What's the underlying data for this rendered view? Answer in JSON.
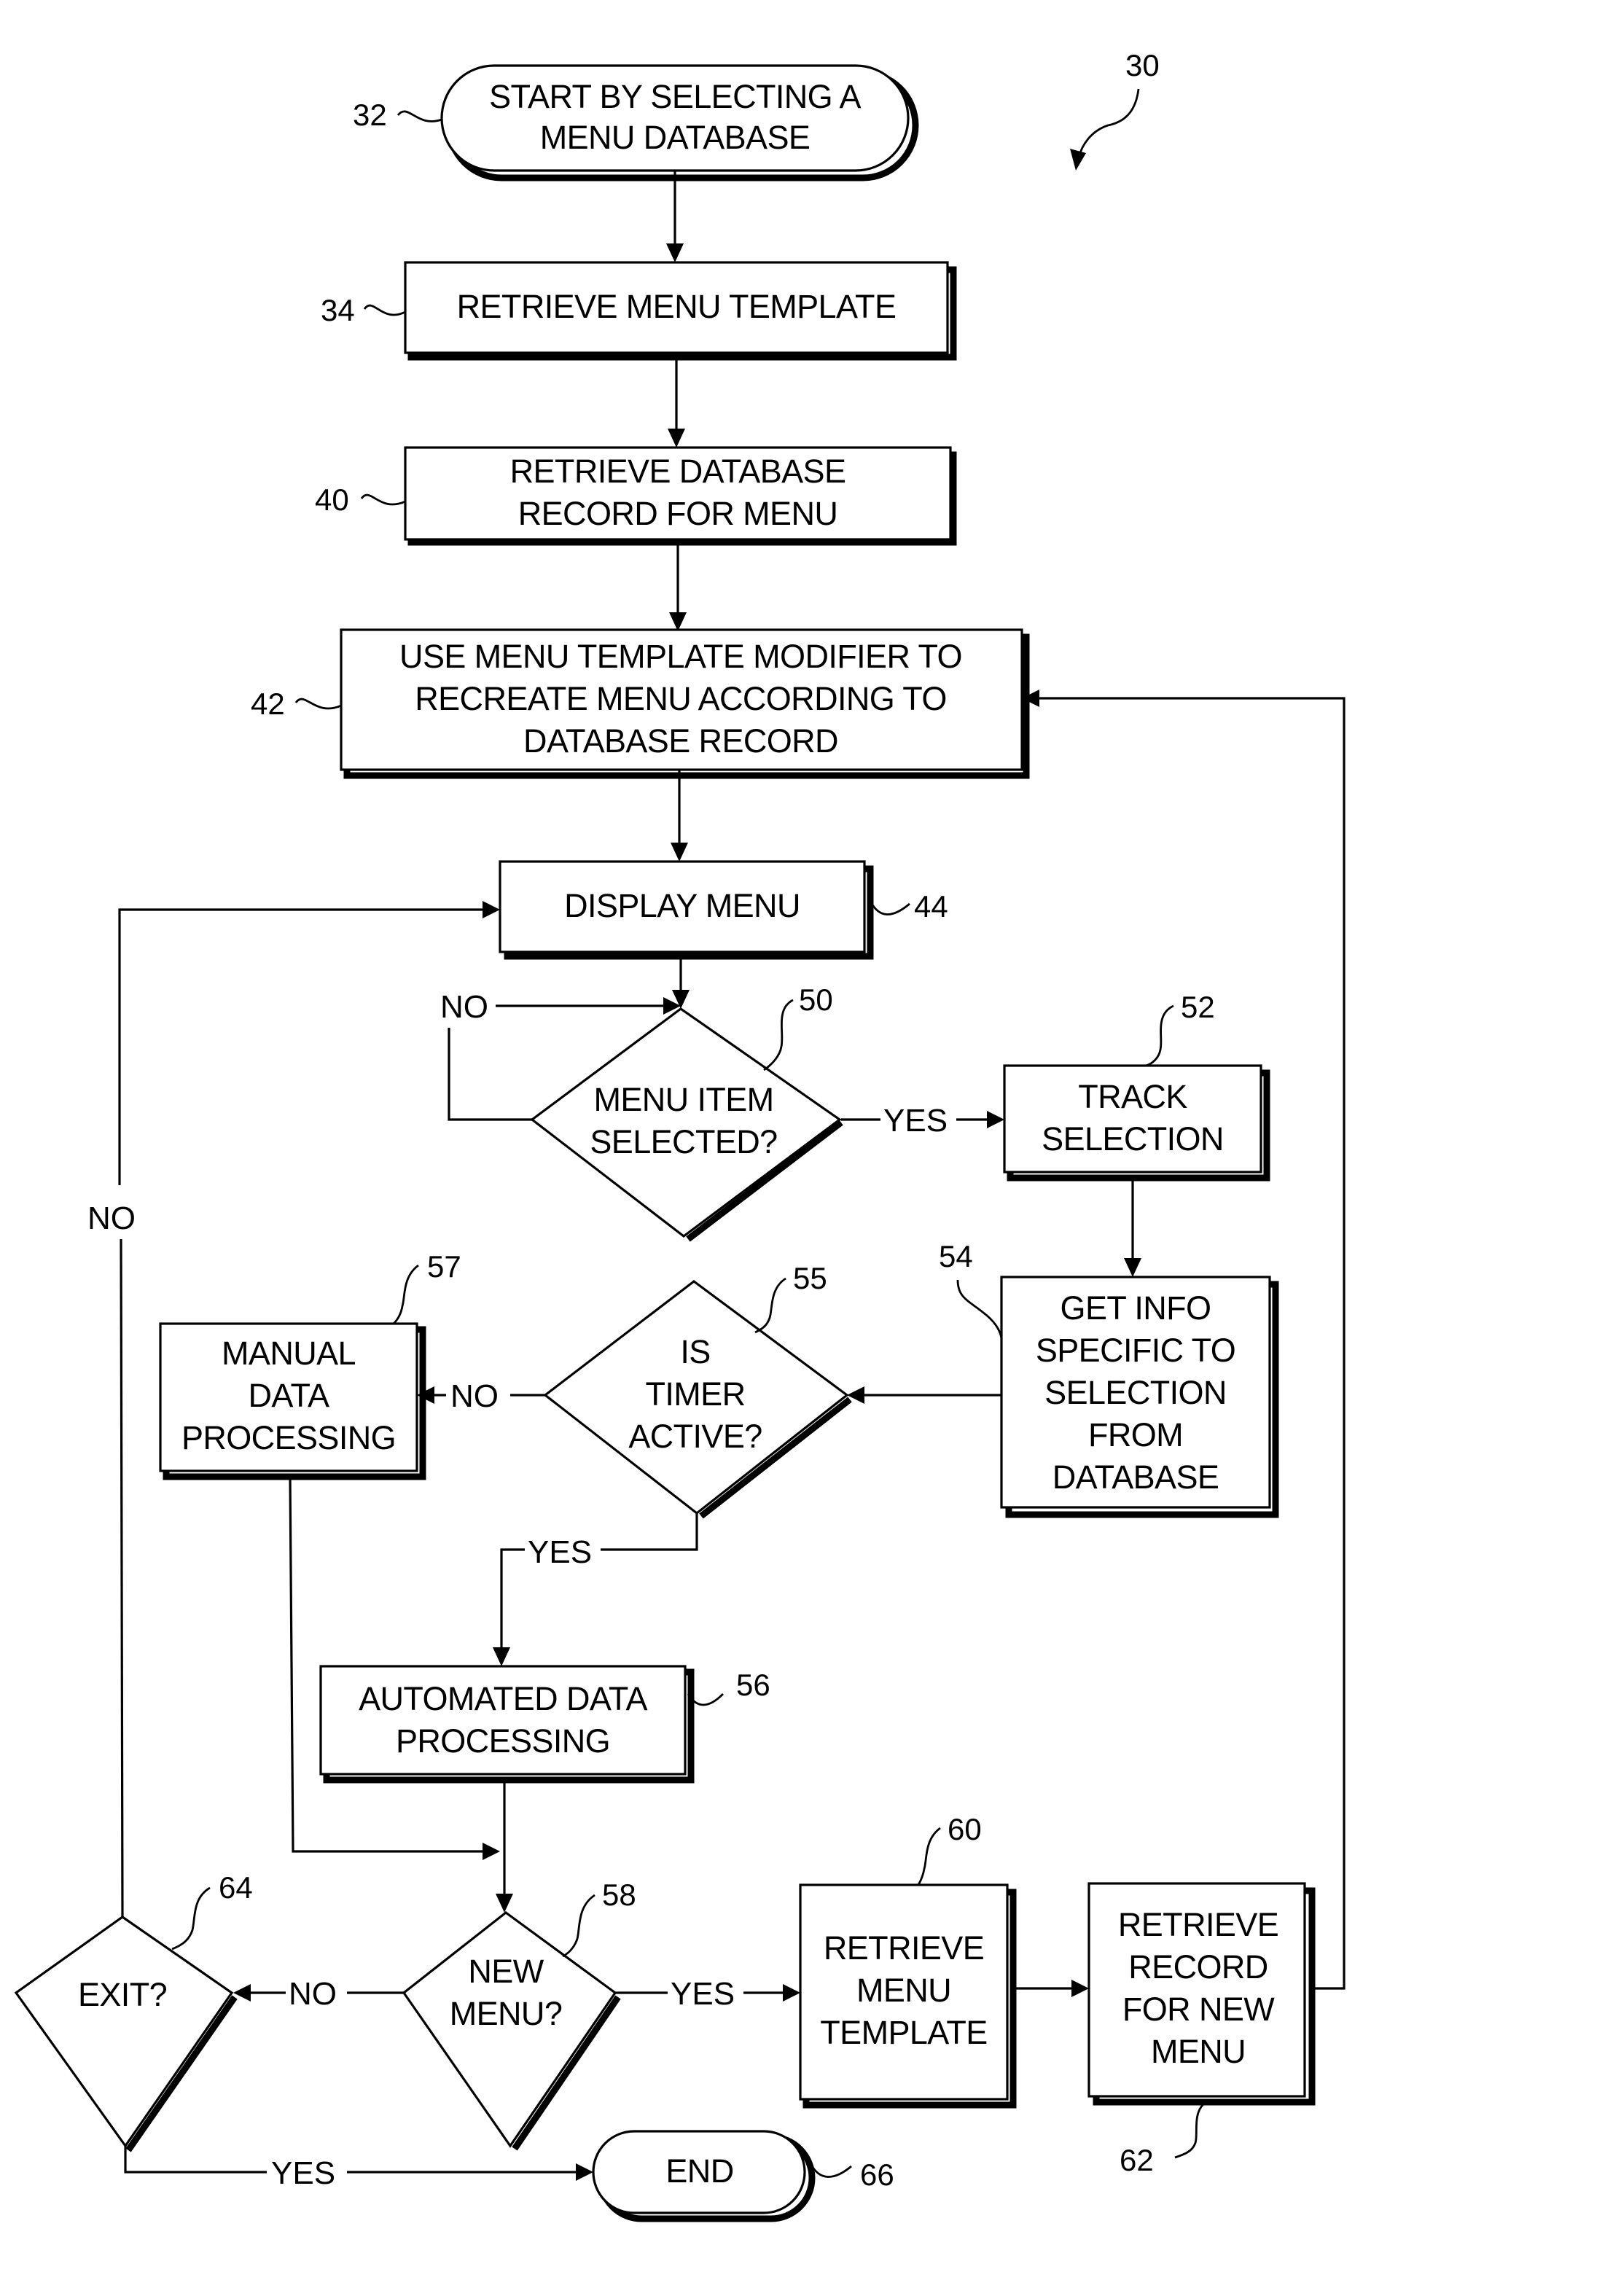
{
  "figure": {
    "reference": "30",
    "colors": {
      "ink": "#000000",
      "paper": "#ffffff"
    }
  },
  "nodes": {
    "n32": {
      "ref": "32",
      "kind": "terminal",
      "lines": [
        "START BY SELECTING A",
        "MENU DATABASE"
      ]
    },
    "n34": {
      "ref": "34",
      "kind": "process",
      "lines": [
        "RETRIEVE MENU TEMPLATE"
      ]
    },
    "n40": {
      "ref": "40",
      "kind": "process",
      "lines": [
        "RETRIEVE DATABASE",
        "RECORD FOR MENU"
      ]
    },
    "n42": {
      "ref": "42",
      "kind": "process",
      "lines": [
        "USE MENU TEMPLATE MODIFIER TO",
        "RECREATE MENU ACCORDING TO",
        "DATABASE RECORD"
      ]
    },
    "n44": {
      "ref": "44",
      "kind": "process",
      "lines": [
        "DISPLAY MENU"
      ]
    },
    "n50": {
      "ref": "50",
      "kind": "decision",
      "lines": [
        "MENU ITEM",
        "SELECTED?"
      ]
    },
    "n52": {
      "ref": "52",
      "kind": "process",
      "lines": [
        "TRACK",
        "SELECTION"
      ]
    },
    "n54": {
      "ref": "54",
      "kind": "process",
      "lines": [
        "GET INFO",
        "SPECIFIC TO",
        "SELECTION",
        "FROM",
        "DATABASE"
      ]
    },
    "n55": {
      "ref": "55",
      "kind": "decision",
      "lines": [
        "IS",
        "TIMER",
        "ACTIVE?"
      ]
    },
    "n57": {
      "ref": "57",
      "kind": "process",
      "lines": [
        "MANUAL",
        "DATA",
        "PROCESSING"
      ]
    },
    "n56": {
      "ref": "56",
      "kind": "process",
      "lines": [
        "AUTOMATED DATA",
        "PROCESSING"
      ]
    },
    "n58": {
      "ref": "58",
      "kind": "decision",
      "lines": [
        "NEW",
        "MENU?"
      ]
    },
    "n60": {
      "ref": "60",
      "kind": "process",
      "lines": [
        "RETRIEVE",
        "MENU",
        "TEMPLATE"
      ]
    },
    "n62": {
      "ref": "62",
      "kind": "process",
      "lines": [
        "RETRIEVE",
        "RECORD",
        "FOR NEW",
        "MENU"
      ]
    },
    "n64": {
      "ref": "64",
      "kind": "decision",
      "lines": [
        "EXIT?"
      ]
    },
    "n66": {
      "ref": "66",
      "kind": "terminal",
      "lines": [
        "END"
      ]
    }
  },
  "edges": [
    {
      "from": "32",
      "to": "34",
      "label": ""
    },
    {
      "from": "34",
      "to": "40",
      "label": ""
    },
    {
      "from": "40",
      "to": "42",
      "label": ""
    },
    {
      "from": "42",
      "to": "44",
      "label": ""
    },
    {
      "from": "44",
      "to": "50",
      "label": ""
    },
    {
      "from": "50",
      "to": "50",
      "label": "NO"
    },
    {
      "from": "50",
      "to": "52",
      "label": "YES"
    },
    {
      "from": "52",
      "to": "54",
      "label": ""
    },
    {
      "from": "54",
      "to": "55",
      "label": ""
    },
    {
      "from": "55",
      "to": "57",
      "label": "NO"
    },
    {
      "from": "55",
      "to": "56",
      "label": "YES"
    },
    {
      "from": "57",
      "to": "58",
      "label": ""
    },
    {
      "from": "56",
      "to": "58",
      "label": ""
    },
    {
      "from": "58",
      "to": "64",
      "label": "NO"
    },
    {
      "from": "58",
      "to": "60",
      "label": "YES"
    },
    {
      "from": "60",
      "to": "62",
      "label": ""
    },
    {
      "from": "62",
      "to": "42",
      "label": ""
    },
    {
      "from": "64",
      "to": "44",
      "label": "NO"
    },
    {
      "from": "64",
      "to": "66",
      "label": "YES"
    }
  ],
  "edge_labels": {
    "e50_no": "NO",
    "e50_yes": "YES",
    "e55_no": "NO",
    "e55_yes": "YES",
    "e58_no": "NO",
    "e58_yes": "YES",
    "e64_no": "NO",
    "e64_yes": "YES"
  }
}
